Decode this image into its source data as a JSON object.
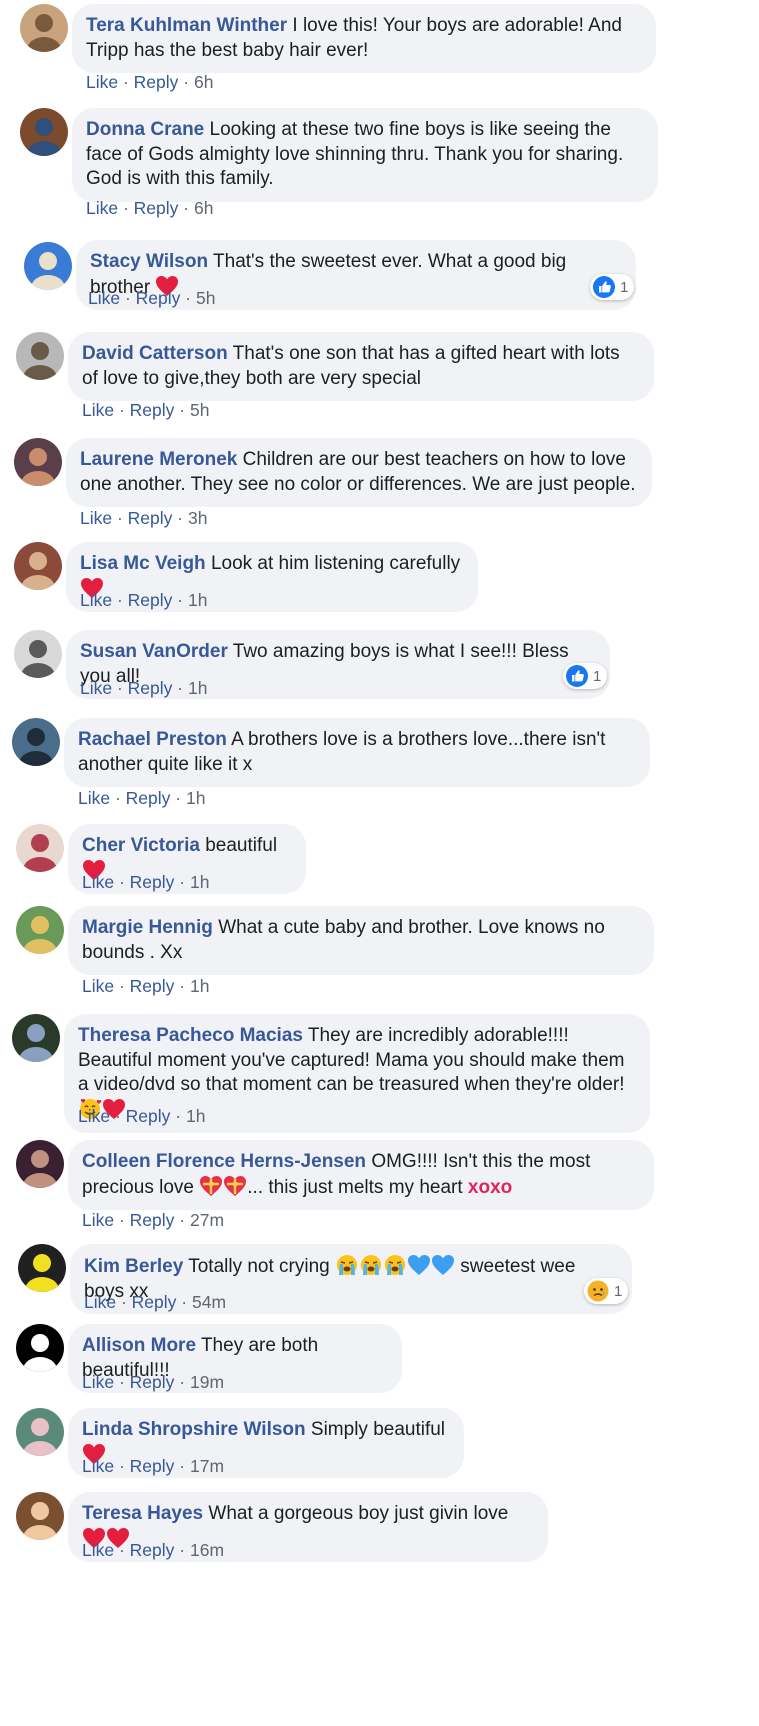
{
  "ui": {
    "like_label": "Like",
    "reply_label": "Reply",
    "separator": "·"
  },
  "colors": {
    "author": "#385898",
    "bubble": "#f0f2f5",
    "text": "#1c1e21",
    "heart": "#e41e3f",
    "like_blue": "#1877f2",
    "highlight": "#e0245e"
  },
  "comments": [
    {
      "author": "Tera Kuhlman Winther",
      "segments": [
        {
          "text": "I love this! Your boys are adorable! And Tripp has the best baby hair ever!"
        }
      ],
      "time": "6h"
    },
    {
      "author": "Donna Crane",
      "segments": [
        {
          "text": "Looking at these two fine boys is like seeing the face of Gods almighty love shinning thru. Thank you for sharing. God is with this family."
        }
      ],
      "time": "6h"
    },
    {
      "author": "Stacy Wilson",
      "segments": [
        {
          "text": "That's the sweetest ever. What a good big brother "
        },
        {
          "emoji": "red-heart"
        }
      ],
      "time": "5h",
      "reaction": {
        "icon": "thumbs-up-icon",
        "count": "1"
      }
    },
    {
      "author": "David Catterson",
      "segments": [
        {
          "text": "That's one son that has a gifted heart with lots of love to give,they both are very special"
        }
      ],
      "time": "5h"
    },
    {
      "author": "Laurene Meronek",
      "segments": [
        {
          "text": "Children are our best teachers on how to love one another. They see no color or differences. We are just people."
        }
      ],
      "time": "3h"
    },
    {
      "author": "Lisa Mc Veigh",
      "segments": [
        {
          "text": "Look at him listening carefully "
        },
        {
          "emoji": "red-heart"
        }
      ],
      "time": "1h"
    },
    {
      "author": "Susan VanOrder",
      "segments": [
        {
          "text": "Two amazing boys is what I see!!! Bless you all!"
        }
      ],
      "time": "1h",
      "reaction": {
        "icon": "thumbs-up-icon",
        "count": "1"
      }
    },
    {
      "author": "Rachael Preston",
      "segments": [
        {
          "text": "A brothers love is a brothers love...there isn't another quite like it x"
        }
      ],
      "time": "1h"
    },
    {
      "author": "Cher Victoria",
      "segments": [
        {
          "text": "beautiful "
        },
        {
          "emoji": "red-heart"
        }
      ],
      "time": "1h"
    },
    {
      "author": "Margie Hennig",
      "segments": [
        {
          "text": "What a cute baby and brother. Love knows no bounds . Xx"
        }
      ],
      "time": "1h"
    },
    {
      "author": "Theresa Pacheco Macias",
      "segments": [
        {
          "text": "They are incredibly adorable!!!! Beautiful moment you've captured! Mama you should make them a video/dvd so that moment can be treasured when they're older!"
        },
        {
          "emoji": "smiling-face-hearts"
        },
        {
          "emoji": "red-heart"
        }
      ],
      "time": "1h"
    },
    {
      "author": "Colleen Florence Herns-Jensen",
      "segments": [
        {
          "text": "OMG!!!! Isn't this the most precious love "
        },
        {
          "emoji": "heart-with-ribbon"
        },
        {
          "emoji": "heart-with-ribbon"
        },
        {
          "text": "... this just melts my heart "
        },
        {
          "highlight": "xoxo"
        }
      ],
      "time": "27m"
    },
    {
      "author": "Kim Berley",
      "segments": [
        {
          "text": "Totally not crying "
        },
        {
          "emoji": "loudly-crying-face"
        },
        {
          "emoji": "loudly-crying-face"
        },
        {
          "emoji": "loudly-crying-face"
        },
        {
          "emoji": "blue-heart"
        },
        {
          "emoji": "blue-heart"
        },
        {
          "text": " sweetest wee boys xx"
        }
      ],
      "time": "54m",
      "reaction": {
        "icon": "sad-face-icon",
        "count": "1"
      }
    },
    {
      "author": "Allison More",
      "segments": [
        {
          "text": "They are both beautiful!!!"
        }
      ],
      "time": "19m"
    },
    {
      "author": "Linda Shropshire Wilson",
      "segments": [
        {
          "text": "Simply beautiful "
        },
        {
          "emoji": "red-heart"
        }
      ],
      "time": "17m"
    },
    {
      "author": "Teresa Hayes",
      "segments": [
        {
          "text": "What a gorgeous boy just givin love "
        },
        {
          "emoji": "red-heart"
        },
        {
          "emoji": "red-heart"
        }
      ],
      "time": "16m"
    }
  ]
}
